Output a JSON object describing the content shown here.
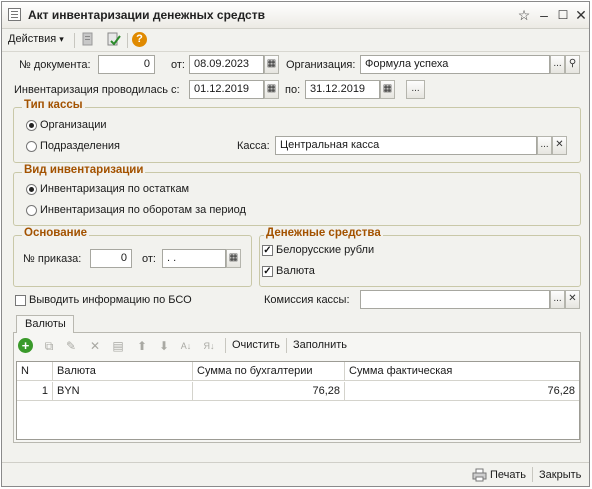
{
  "window": {
    "title": "Акт инвентаризации денежных средств"
  },
  "toolbar": {
    "actions_label": "Действия",
    "actions_arrow": "▾"
  },
  "doc": {
    "number_label": "№ документа:",
    "number_value": "0",
    "date_from_label": "от:",
    "date_value": "08.09.2023",
    "org_label": "Организация:",
    "org_value": "Формула успеха"
  },
  "period": {
    "label": "Инвентаризация проводилась с:",
    "from_value": "01.12.2019",
    "to_label": "по:",
    "to_value": "31.12.2019",
    "ellipsis": "..."
  },
  "cash_type": {
    "title": "Тип кассы",
    "opt_org": "Организации",
    "opt_div": "Подразделения",
    "kassa_label": "Касса:",
    "kassa_value": "Центральная касса"
  },
  "inv_type": {
    "title": "Вид инвентаризации",
    "opt_balance": "Инвентаризация по остаткам",
    "opt_turnover": "Инвентаризация по оборотам за период"
  },
  "basis": {
    "title": "Основание",
    "order_label": "№ приказа:",
    "order_value": "0",
    "date_label": "от:",
    "date_value": " .  ."
  },
  "money": {
    "title": "Денежные средства",
    "byr_label": "Белорусские рубли",
    "currency_label": "Валюта"
  },
  "bso": {
    "label": "Выводить информацию по БСО"
  },
  "commission": {
    "label": "Комиссия кассы:",
    "value": ""
  },
  "tab": {
    "label": "Валюты"
  },
  "table_toolbar": {
    "clear_label": "Очистить",
    "fill_label": "Заполнить"
  },
  "table": {
    "headers": [
      "N",
      "Валюта",
      "Сумма по бухгалтерии",
      "Сумма фактическая"
    ],
    "rows": [
      {
        "n": "1",
        "currency": "BYN",
        "book": "76,28",
        "actual": "76,28"
      }
    ]
  },
  "footer": {
    "print_label": "Печать",
    "close_label": "Закрыть"
  },
  "colors": {
    "group_title": "#a35200",
    "add_icon": "#3a9a2a",
    "help_icon": "#e08a00"
  }
}
